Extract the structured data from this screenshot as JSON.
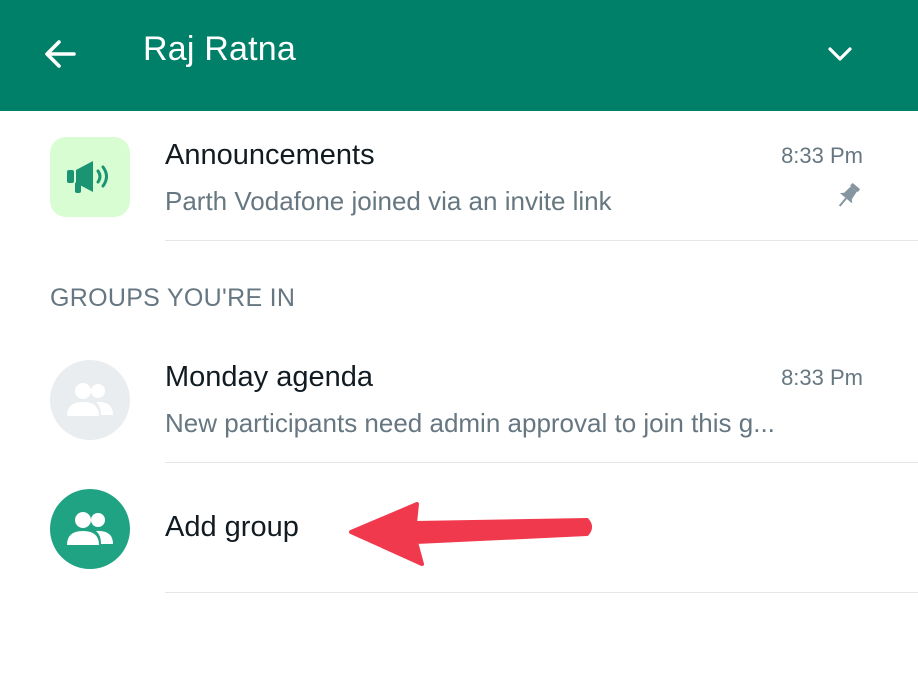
{
  "header": {
    "title": "Raj Ratna",
    "back_icon": "arrow-left-icon",
    "menu_icon": "chevron-down-icon",
    "background": "#008069"
  },
  "announcements": {
    "title": "Announcements",
    "subtitle": "Parth Vodafone joined via an invite link",
    "time": "8:33 Pm",
    "icon": "megaphone-icon",
    "pinned_icon": "pin-icon"
  },
  "section": {
    "label": "GROUPS YOU'RE IN"
  },
  "groups": [
    {
      "title": "Monday agenda",
      "subtitle": "New participants need admin approval to join this g...",
      "time": "8:33 Pm",
      "icon": "group-icon"
    }
  ],
  "add_group": {
    "label": "Add group",
    "icon": "group-icon"
  },
  "annotation": {
    "arrow_color": "#f0394d"
  }
}
